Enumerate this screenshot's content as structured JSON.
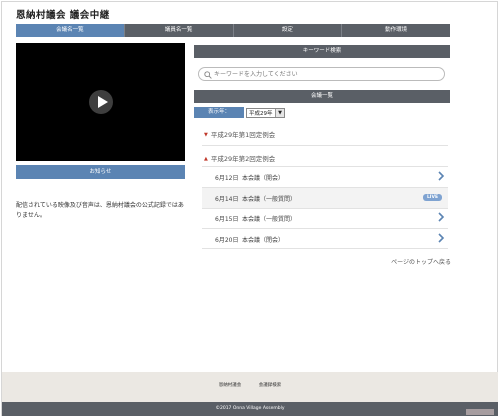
{
  "site": {
    "title": "恩納村議会 議会中継"
  },
  "nav": {
    "items": [
      {
        "label": "会議名一覧",
        "active": true
      },
      {
        "label": "議員名一覧",
        "active": false
      },
      {
        "label": "設定",
        "active": false
      },
      {
        "label": "動作環境",
        "active": false
      }
    ]
  },
  "video": {
    "play_icon": "play-icon"
  },
  "notice": {
    "label": "お知らせ"
  },
  "disclaimer": {
    "text": "配信されている映像及び音声は、恩納村議会の公式記録ではありません。"
  },
  "keyword": {
    "header": "キーワード検索",
    "placeholder": "キーワードを入力してください",
    "icon": "search-icon"
  },
  "meetings": {
    "header": "会議一覧",
    "year_label": "表示年：",
    "year_value": "平成29年",
    "sessions": [
      {
        "label": "平成29年第1回定例会"
      },
      {
        "label": "平成29年第2回定例会"
      }
    ],
    "items": [
      {
        "date": "6月12日",
        "name": "本会議（開会）",
        "live": false
      },
      {
        "date": "6月14日",
        "name": "本会議（一般質問）",
        "live": true
      },
      {
        "date": "6月15日",
        "name": "本会議（一般質問）",
        "live": false
      },
      {
        "date": "6月20日",
        "name": "本会議（閉会）",
        "live": false
      }
    ],
    "live_label": "LIVE"
  },
  "to_top": {
    "label": "ページのトップへ戻る"
  },
  "footer": {
    "links": [
      "恩納村議会",
      "会議録検索"
    ],
    "copyright": "©2017 Onna Village Assembly"
  },
  "colors": {
    "nav_bg": "#5a5f66",
    "accent": "#5b84b3",
    "session_marker": "#c0392b",
    "footer_bg": "#ebe8e3"
  }
}
